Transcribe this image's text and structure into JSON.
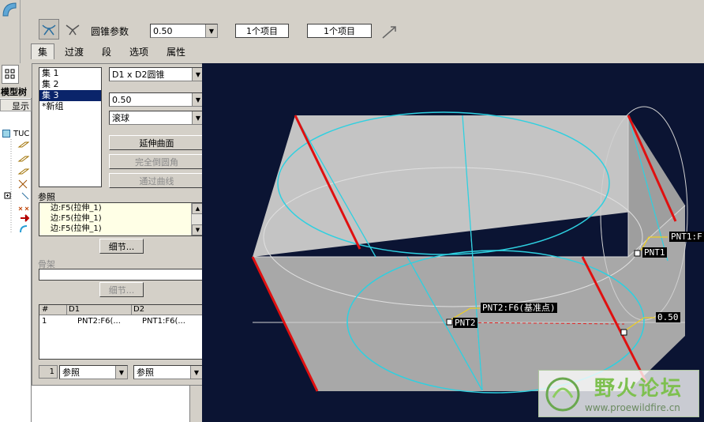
{
  "toolbar": {
    "param_label": "圆锥参数",
    "param_value": "0.50",
    "ref1": "1个项目",
    "ref2": "1个项目"
  },
  "tabs": [
    "集",
    "过渡",
    "段",
    "选项",
    "属性"
  ],
  "model_tree": {
    "title": "模型树",
    "display": "显示",
    "root": "TUC"
  },
  "sets_panel": {
    "sets": [
      "集 1",
      "集 2",
      "集 3",
      "*新组"
    ],
    "selected_index": 2,
    "shape": "D1 x D2圆锥",
    "value": "0.50",
    "type": "滚球",
    "btn_extend": "延伸曲面",
    "btn_full": "完全倒圆角",
    "btn_curve": "通过曲线",
    "ref_label": "参照",
    "references": [
      "边:F5(拉伸_1)",
      "边:F5(拉伸_1)",
      "边:F5(拉伸_1)"
    ],
    "details_btn": "细节...",
    "skeleton_label": "骨架",
    "details_btn2": "细节...",
    "table": {
      "headers": [
        "#",
        "D1",
        "D2"
      ],
      "rows": [
        [
          "1",
          "PNT2:F6(...",
          "PNT1:F6(..."
        ]
      ]
    },
    "bottom_num": "1",
    "bottom_sel1": "参照",
    "bottom_sel2": "参照"
  },
  "viewport": {
    "labels": {
      "pnt1_top": "PNT1:F",
      "pnt1": "PNT1",
      "pnt2_top": "PNT2:F6(基准点)",
      "pnt2": "PNT2",
      "val": "0.50"
    }
  },
  "watermark": {
    "title": "野火论坛",
    "url": "www.proewildfire.cn"
  }
}
